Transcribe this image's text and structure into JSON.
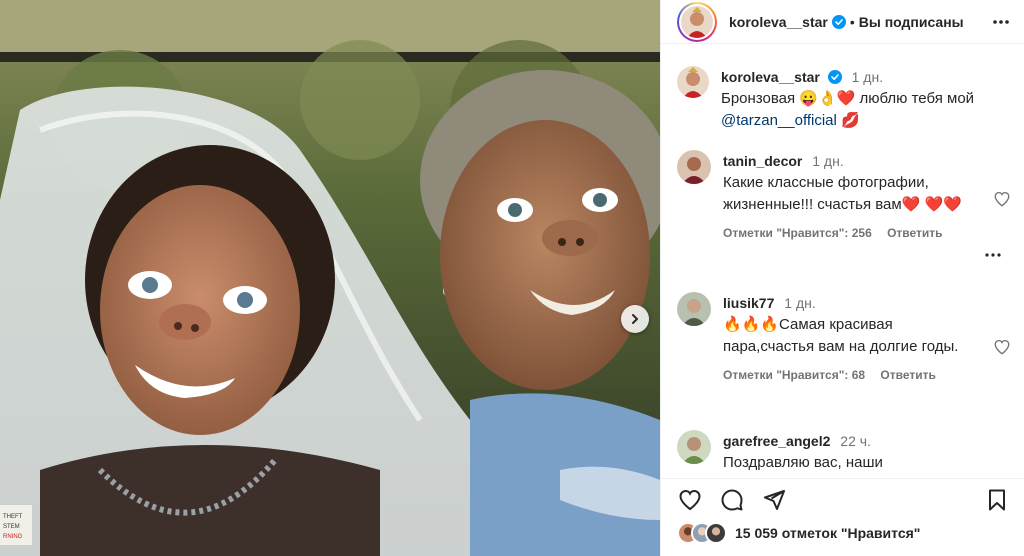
{
  "post": {
    "author": "koroleva__star",
    "follow_status": "Вы подписаны",
    "caption": {
      "username": "koroleva__star",
      "time": "1 дн.",
      "text_before": "Бронзовая 😛👌❤️ люблю тебя мой",
      "mention": "@tarzan__official",
      "text_after": "💋"
    }
  },
  "comments": [
    {
      "username": "tanin_decor",
      "time": "1 дн.",
      "text": "Какие классные фотографии, жизненные!!! счастья вам❤️ ❤️❤️",
      "likes_label": "Отметки \"Нравится\": 256",
      "reply_label": "Ответить"
    },
    {
      "username": "liusik77",
      "time": "1 дн.",
      "text": "🔥🔥🔥Самая красивая пара,счастья вам на долгие годы.",
      "likes_label": "Отметки \"Нравится\": 68",
      "reply_label": "Ответить"
    },
    {
      "username": "garefree_angel2",
      "time": "22 ч.",
      "text": "Поздравляю вас, наши"
    }
  ],
  "likes": {
    "text": "15 059 отметок \"Нравится\""
  },
  "icons": {
    "more": "more-horizontal-icon",
    "verified": "verified-badge-icon",
    "like": "heart-icon",
    "comment": "comment-icon",
    "share": "share-icon",
    "save": "bookmark-icon",
    "next": "chevron-right-icon"
  },
  "colors": {
    "verified": "#0095f6",
    "link": "#00376b",
    "muted": "#737373"
  }
}
